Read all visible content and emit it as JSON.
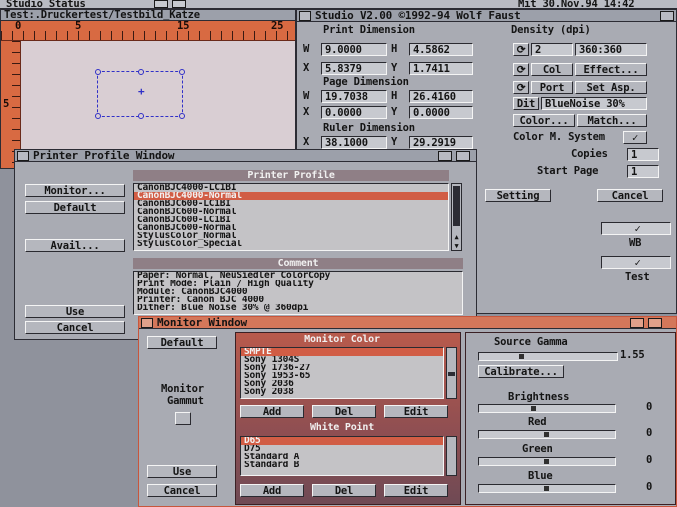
{
  "screen_title": "Studio Status",
  "clock": "Mit 30.Nov.94  14:42",
  "status_window": {
    "title": "Test:.Druckertest/Testbild_Katze",
    "ruler_labels": [
      "0",
      "5",
      "15",
      "25"
    ],
    "left_ruler_label": "5"
  },
  "studio_window": {
    "title": "Studio V2.00   ©1992-94 Wolf Faust",
    "print_dimension": {
      "label": "Print Dimension",
      "w": "9.0000",
      "h": "4.5862",
      "x": "5.8379",
      "y": "1.7411"
    },
    "page_dimension": {
      "label": "Page Dimension",
      "w": "19.7038",
      "h": "26.4160",
      "x": "0.0000",
      "y": "0.0000"
    },
    "ruler_dimension": {
      "label": "Ruler Dimension",
      "x": "38.1000",
      "y": "29.2919"
    },
    "field_labels": {
      "w": "W",
      "h": "H",
      "x": "X",
      "y": "Y"
    },
    "density": {
      "label": "Density (dpi)",
      "mode": "2",
      "value": "360:360"
    },
    "buttons": {
      "col": "Col",
      "effect": "Effect...",
      "port": "Port",
      "set_asp": "Set Asp.",
      "dit": "Dit",
      "color": "Color...",
      "match": "Match...",
      "setting": "Setting",
      "cancel": "Cancel"
    },
    "dither_value": "BlueNoise 30%",
    "color_system_label": "Color M. System",
    "checkmark": "✓",
    "copies_label": "Copies",
    "copies_value": "1",
    "start_page_label": "Start Page",
    "start_page_value": "1",
    "wb_label": "WB",
    "test_label": "Test"
  },
  "printer_profile_window": {
    "title": "Printer Profile Window",
    "buttons": {
      "monitor": "Monitor...",
      "default": "Default",
      "avail": "Avail...",
      "use": "Use",
      "cancel": "Cancel"
    },
    "profile_header": "Printer Profile",
    "profiles": [
      "CanonBJC4000-LC1BI",
      "CanonBJC4000-Normal",
      "CanonBJC600-LC1BI",
      "CanonBJC600-Normal",
      "CanonBJC600-LC1BI",
      "CanonBJC600-Normal",
      "StylusColor_Normal",
      "StylusColor_Special"
    ],
    "comment_header": "Comment",
    "comment_lines": [
      "Paper: Normal, NeuSiedler ColorCopy",
      "Print Mode: Plain / High Quality",
      "Module:       CanonBJC4000",
      "Printer:      Canon BJC 4000",
      "Dither:       Blue Noise 30% @ 360dpi"
    ]
  },
  "monitor_window": {
    "title": "Monitor Window",
    "default_button": "Default",
    "gamut_label_1": "Monitor",
    "gamut_label_2": "Gammut",
    "use_button": "Use",
    "cancel_button": "Cancel",
    "color_header": "Monitor Color",
    "colors": [
      "SMPTE",
      "Sony 1304S",
      "Sony 1736-27",
      "Sony 1953-65",
      "Sony 2036",
      "Sony 2038"
    ],
    "add_button": "Add",
    "del_button": "Del",
    "edit_button": "Edit",
    "white_point_header": "White Point",
    "white_points": [
      "D65",
      "D75",
      "Standard A",
      "Standard B"
    ],
    "source_gamma_label": "Source Gamma",
    "source_gamma_value": "1.55",
    "source_gamma_level": 0.3,
    "calibrate_button": "Calibrate...",
    "brightness_label": "Brightness",
    "brightness_value": "0",
    "brightness_level": 0.4,
    "red_label": "Red",
    "red_value": "0",
    "red_level": 0.5,
    "green_label": "Green",
    "green_value": "0",
    "green_level": 0.5,
    "blue_label": "Blue",
    "blue_value": "0",
    "blue_level": 0.5
  }
}
